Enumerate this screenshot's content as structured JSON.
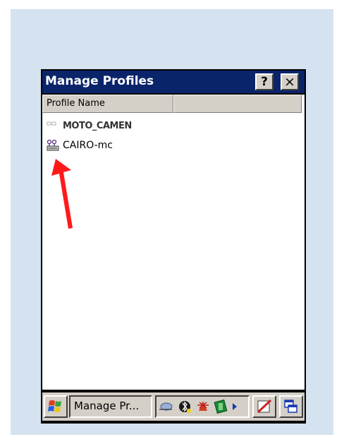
{
  "window": {
    "title": "Manage Profiles",
    "help_label": "?",
    "close_label": "×"
  },
  "list": {
    "columns": [
      "Profile Name",
      ""
    ],
    "profiles": [
      {
        "name": "MOTO_CAMEN",
        "icon": "network-profile-icon"
      },
      {
        "name": "CAIRO-mc",
        "icon": "network-profile-icon"
      }
    ]
  },
  "taskbar": {
    "task_label": "Manage Pr...",
    "start_icon": "windows-flag-icon",
    "tray_icons": [
      "network-icon",
      "bluetooth-icon",
      "wireless-icon",
      "power-icon",
      "expand-arrow-icon"
    ],
    "pen_icon": "pen-input-icon",
    "windows_icon": "window-switch-icon"
  },
  "colors": {
    "titlebar": "#0a246a",
    "background": "#d5e2ef",
    "arrow": "#ff0000"
  }
}
